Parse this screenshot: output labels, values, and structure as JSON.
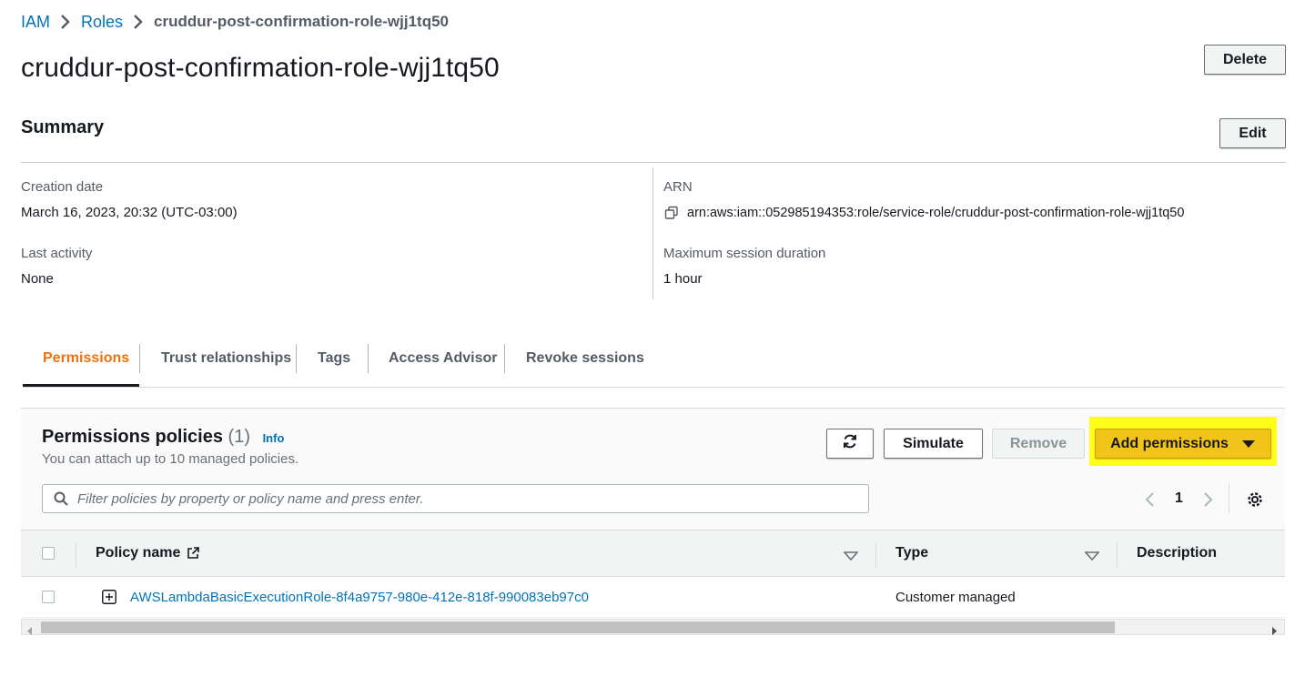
{
  "breadcrumb": {
    "items": [
      "IAM",
      "Roles"
    ],
    "current": "cruddur-post-confirmation-role-wjj1tq50"
  },
  "page_title": "cruddur-post-confirmation-role-wjj1tq50",
  "buttons": {
    "delete": "Delete",
    "edit": "Edit"
  },
  "summary": {
    "title": "Summary",
    "creation_date_label": "Creation date",
    "creation_date_value": "March 16, 2023, 20:32 (UTC-03:00)",
    "last_activity_label": "Last activity",
    "last_activity_value": "None",
    "arn_label": "ARN",
    "arn_value": "arn:aws:iam::052985194353:role/service-role/cruddur-post-confirmation-role-wjj1tq50",
    "max_session_label": "Maximum session duration",
    "max_session_value": "1 hour"
  },
  "tabs": [
    "Permissions",
    "Trust relationships",
    "Tags",
    "Access Advisor",
    "Revoke sessions"
  ],
  "active_tab": "Permissions",
  "permissions": {
    "title": "Permissions policies",
    "count": "(1)",
    "info": "Info",
    "description": "You can attach up to 10 managed policies.",
    "simulate": "Simulate",
    "remove": "Remove",
    "add_permissions": "Add permissions",
    "search_placeholder": "Filter policies by property or policy name and press enter.",
    "page_number": "1",
    "columns": [
      "Policy name",
      "Type",
      "Description"
    ],
    "rows": [
      {
        "name": "AWSLambdaBasicExecutionRole-8f4a9757-980e-412e-818f-990083eb97c0",
        "type": "Customer managed",
        "description": ""
      }
    ]
  },
  "colors": {
    "link": "#0073bb",
    "active_tab": "#ec7211",
    "highlight": "#ffff1a",
    "primary_button": "#f2c318"
  }
}
